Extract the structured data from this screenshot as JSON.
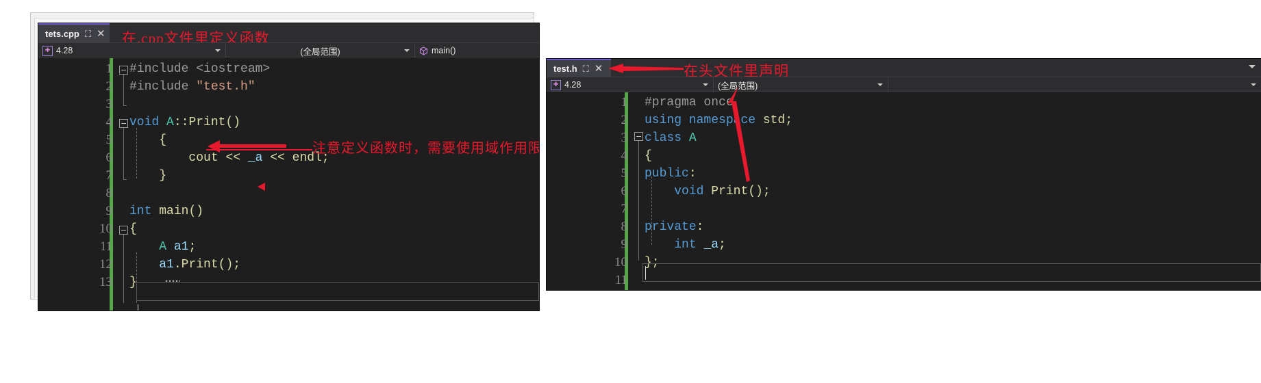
{
  "meta": {
    "accent_tab_underline": "#6a5acd",
    "annotation_color": "#e8192c",
    "editor_bg": "#1e1e1e",
    "chrome_bg": "#2d2d30",
    "changebar_color": "#57a64a"
  },
  "left_window": {
    "tab": {
      "name": "tets.cpp",
      "pin_icon": "pin-icon",
      "close_icon": "close-icon"
    },
    "navbar": {
      "project_icon": "project-icon",
      "project": "4.28",
      "scope": "(全局范围)",
      "member_icon": "cube-icon",
      "member": "main()"
    },
    "annotation": "在.cpp文件里定义函数",
    "inline_annotation": "注意定义函数时，需要使用域作用限定符",
    "lines": [
      {
        "n": "1",
        "tokens": [
          {
            "t": "#include ",
            "c": "c-pre"
          },
          {
            "t": "<iostream>",
            "c": "c-pre"
          }
        ]
      },
      {
        "n": "2",
        "tokens": [
          {
            "t": "#include ",
            "c": "c-pre"
          },
          {
            "t": "\"test.h\"",
            "c": "c-str"
          }
        ]
      },
      {
        "n": "3",
        "tokens": []
      },
      {
        "n": "4",
        "tokens": [
          {
            "t": "void ",
            "c": "c-kw"
          },
          {
            "t": "A",
            "c": "c-type"
          },
          {
            "t": "::",
            "c": "c-pln"
          },
          {
            "t": "Print",
            "c": "c-pln"
          },
          {
            "t": "()",
            "c": "c-pun"
          }
        ]
      },
      {
        "n": "5",
        "tokens": [
          {
            "t": "    {",
            "c": "c-pun"
          }
        ]
      },
      {
        "n": "6",
        "tokens": [
          {
            "t": "        cout << ",
            "c": "c-pln"
          },
          {
            "t": "_a",
            "c": "c-var"
          },
          {
            "t": " << endl;",
            "c": "c-pln"
          }
        ]
      },
      {
        "n": "7",
        "tokens": [
          {
            "t": "    }",
            "c": "c-pun"
          }
        ]
      },
      {
        "n": "8",
        "tokens": []
      },
      {
        "n": "9",
        "tokens": [
          {
            "t": "int ",
            "c": "c-kw"
          },
          {
            "t": "main",
            "c": "c-pln"
          },
          {
            "t": "()",
            "c": "c-pun"
          }
        ]
      },
      {
        "n": "10",
        "tokens": [
          {
            "t": "{",
            "c": "c-pun"
          }
        ]
      },
      {
        "n": "11",
        "tokens": [
          {
            "t": "    ",
            "c": "c-pln"
          },
          {
            "t": "A",
            "c": "c-type"
          },
          {
            "t": " ",
            "c": "c-pln"
          },
          {
            "t": "a1",
            "c": "c-var"
          },
          {
            "t": ";",
            "c": "c-pun"
          }
        ]
      },
      {
        "n": "12",
        "tokens": [
          {
            "t": "    ",
            "c": "c-pln"
          },
          {
            "t": "a1",
            "c": "c-var"
          },
          {
            "t": ".",
            "c": "c-pun"
          },
          {
            "t": "Print",
            "c": "c-pln"
          },
          {
            "t": "();",
            "c": "c-pun"
          }
        ]
      },
      {
        "n": "13",
        "tokens": [
          {
            "t": "}",
            "c": "c-pun"
          }
        ]
      }
    ]
  },
  "right_window": {
    "tab": {
      "name": "test.h",
      "pin_icon": "pin-icon",
      "close_icon": "close-icon"
    },
    "navbar": {
      "project_icon": "project-icon",
      "project": "4.28",
      "scope": "(全局范围)",
      "member": ""
    },
    "annotation": "在头文件里声明",
    "lines": [
      {
        "n": "1",
        "tokens": [
          {
            "t": "#pragma once",
            "c": "c-pre"
          }
        ]
      },
      {
        "n": "2",
        "tokens": [
          {
            "t": "using namespace ",
            "c": "c-kw"
          },
          {
            "t": "std;",
            "c": "c-pln"
          }
        ]
      },
      {
        "n": "3",
        "tokens": [
          {
            "t": "class ",
            "c": "c-kw"
          },
          {
            "t": "A",
            "c": "c-type"
          }
        ]
      },
      {
        "n": "4",
        "tokens": [
          {
            "t": "{",
            "c": "c-pun"
          }
        ]
      },
      {
        "n": "5",
        "tokens": [
          {
            "t": "public",
            "c": "c-kw"
          },
          {
            "t": ":",
            "c": "c-pln"
          }
        ]
      },
      {
        "n": "6",
        "tokens": [
          {
            "t": "    ",
            "c": "c-pln"
          },
          {
            "t": "void ",
            "c": "c-kw"
          },
          {
            "t": "Print",
            "c": "c-pln"
          },
          {
            "t": "();",
            "c": "c-pun"
          }
        ]
      },
      {
        "n": "7",
        "tokens": []
      },
      {
        "n": "8",
        "tokens": [
          {
            "t": "private",
            "c": "c-kw"
          },
          {
            "t": ":",
            "c": "c-pln"
          }
        ]
      },
      {
        "n": "9",
        "tokens": [
          {
            "t": "    ",
            "c": "c-pln"
          },
          {
            "t": "int ",
            "c": "c-kw"
          },
          {
            "t": "_a",
            "c": "c-var"
          },
          {
            "t": ";",
            "c": "c-pun"
          }
        ]
      },
      {
        "n": "10",
        "tokens": [
          {
            "t": "};",
            "c": "c-pun"
          }
        ]
      },
      {
        "n": "11",
        "tokens": []
      }
    ]
  }
}
